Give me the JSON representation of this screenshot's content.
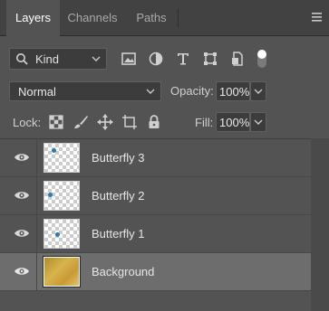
{
  "panel": {
    "tabs": [
      {
        "label": "Layers",
        "active": true
      },
      {
        "label": "Channels",
        "active": false
      },
      {
        "label": "Paths",
        "active": false
      }
    ],
    "menu_icon": "panel-menu-icon"
  },
  "filter": {
    "kind_label": "Kind",
    "icons": [
      "pixel-filter-icon",
      "adjustment-filter-icon",
      "type-filter-icon",
      "shape-filter-icon",
      "smart-object-filter-icon"
    ],
    "toggle_on": true
  },
  "blend": {
    "mode": "Normal",
    "opacity_label": "Opacity:",
    "opacity_value": "100%"
  },
  "lock": {
    "label": "Lock:",
    "icons": [
      "lock-transparent-icon",
      "lock-pixels-icon",
      "lock-position-icon",
      "lock-artboard-icon",
      "lock-all-icon"
    ],
    "fill_label": "Fill:",
    "fill_value": "100%"
  },
  "layers": [
    {
      "name": "Butterfly 3",
      "visible": true,
      "selected": false,
      "type": "transparent"
    },
    {
      "name": "Butterfly 2",
      "visible": true,
      "selected": false,
      "type": "transparent"
    },
    {
      "name": "Butterfly 1",
      "visible": true,
      "selected": false,
      "type": "transparent"
    },
    {
      "name": "Background",
      "visible": true,
      "selected": true,
      "type": "image"
    }
  ],
  "colors": {
    "panel_bg": "#535353",
    "tab_bar_bg": "#424242",
    "selected_row": "#6d6d6d",
    "text": "#e6e6e6"
  }
}
